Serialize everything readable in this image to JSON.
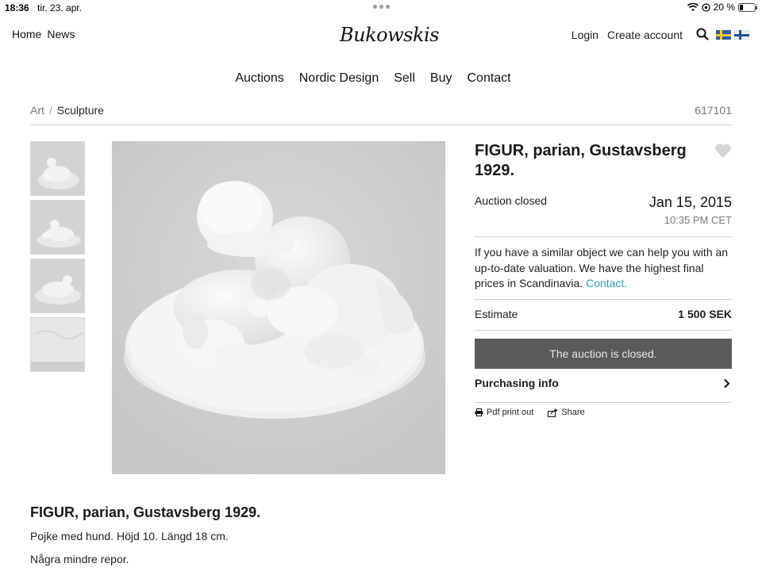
{
  "statusbar": {
    "time": "18:36",
    "date": "tir. 23. apr.",
    "battery": "20 %"
  },
  "header": {
    "nav_left": [
      "Home",
      "News"
    ],
    "logo": "Bukowskis",
    "nav_right": [
      "Login",
      "Create account"
    ]
  },
  "mainnav": [
    "Auctions",
    "Nordic Design",
    "Sell",
    "Buy",
    "Contact"
  ],
  "breadcrumb": {
    "items": [
      "Art",
      "Sculpture"
    ],
    "separator": "/"
  },
  "lot_number": "617101",
  "lot": {
    "title": "FIGUR, parian, Gustavsberg 1929.",
    "status": "Auction closed",
    "date": "Jan 15, 2015",
    "time": "10:35 PM CET",
    "valuation_text": "If you have a similar object we can help you with an up-to-date valuation. We have the highest final prices in Scandinavia.",
    "valuation_link": "Contact.",
    "estimate_label": "Estimate",
    "estimate_value": "1 500 SEK",
    "closed_message": "The auction is closed.",
    "purchasing_info": "Purchasing info",
    "pdf_label": "Pdf print out",
    "share_label": "Share"
  },
  "description": {
    "title": "FIGUR, parian, Gustavsberg 1929.",
    "lines": [
      "Pojke med hund. Höjd 10. Längd 18 cm.",
      "Några mindre repor."
    ]
  },
  "icons": [
    "wifi-icon",
    "location-icon",
    "battery-icon",
    "search-icon",
    "heart-icon",
    "chevron-right-icon",
    "printer-icon",
    "share-icon"
  ],
  "colors": {
    "link": "#2a9dbd",
    "closed_bar": "#5a5a5a",
    "divider": "#cfcfcf"
  }
}
